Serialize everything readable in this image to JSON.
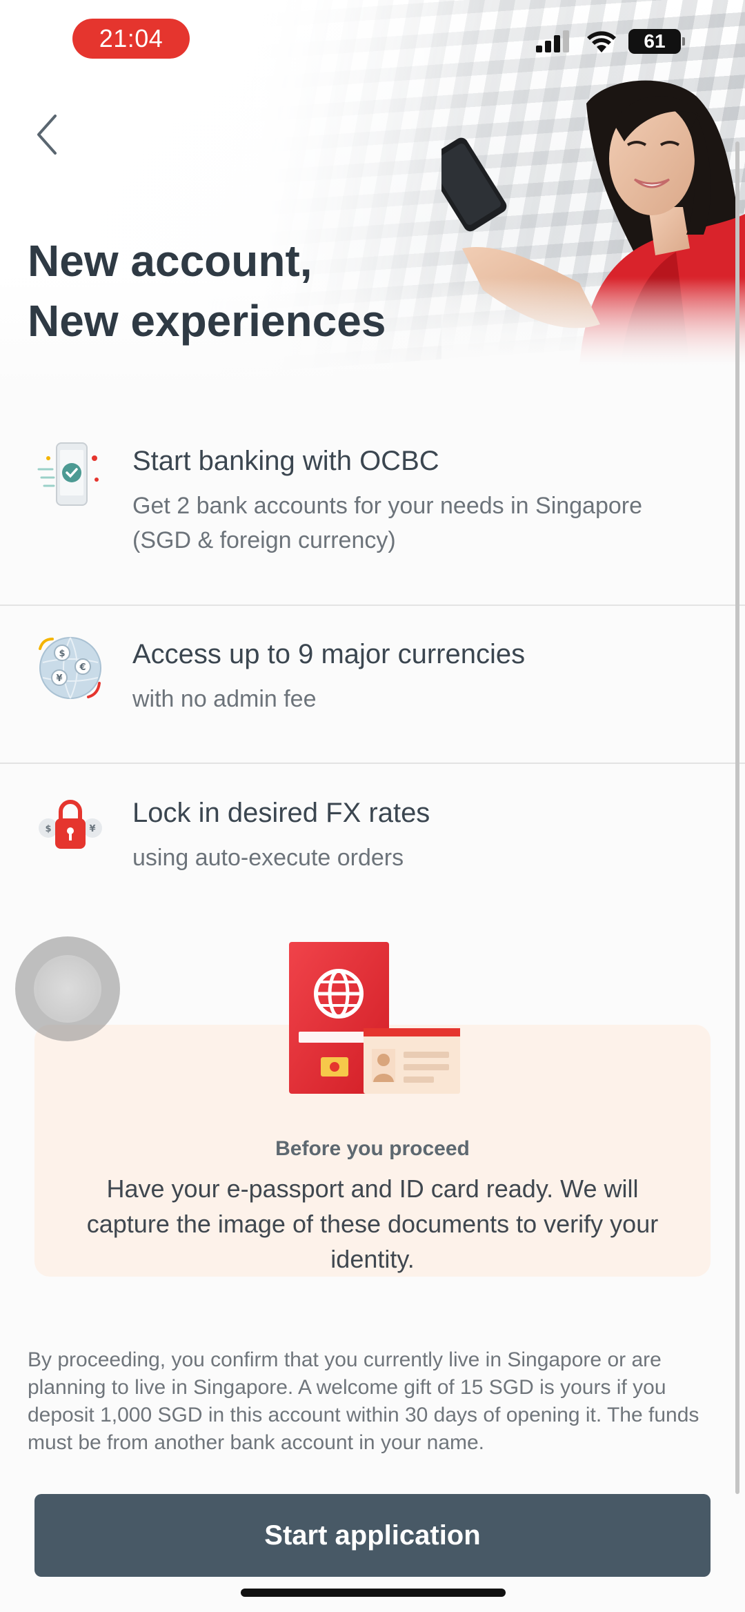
{
  "status_bar": {
    "time": "21:04",
    "battery": "61"
  },
  "header": {
    "title_line1": "New account,",
    "title_line2": "New experiences"
  },
  "features": [
    {
      "icon": "phone-check-icon",
      "title": "Start banking with OCBC",
      "description": "Get 2 bank accounts for your needs in Singapore (SGD & foreign currency)"
    },
    {
      "icon": "currency-globe-icon",
      "title": "Access up to 9 major currencies",
      "description": "with no admin fee"
    },
    {
      "icon": "fx-lock-icon",
      "title": "Lock in desired FX rates",
      "description": "using auto-execute orders"
    }
  ],
  "notice": {
    "heading": "Before you proceed",
    "body": "Have your e-passport and ID card ready. We will capture the image of these documents to verify your identity."
  },
  "disclaimer": "By proceeding, you confirm that you currently live in Singapore or are planning to live in Singapore. A welcome gift of 15 SGD is yours if you deposit 1,000 SGD in this account within 30 days of opening it. The funds must be from another bank account in your name.",
  "cta": {
    "label": "Start application"
  },
  "colors": {
    "accent_red": "#e5352e",
    "cta_bg": "#485966",
    "notice_bg": "#fdf2ea"
  }
}
